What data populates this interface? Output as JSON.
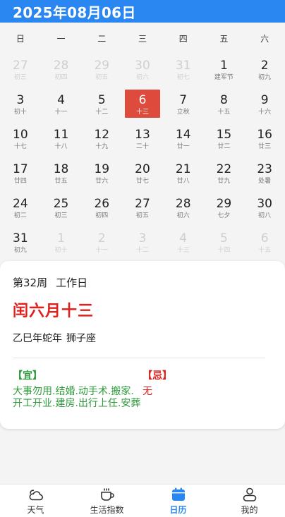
{
  "header": {
    "title": "2025年08月06日"
  },
  "weekdays": [
    "日",
    "一",
    "二",
    "三",
    "四",
    "五",
    "六"
  ],
  "calendar": {
    "days": [
      {
        "d": "27",
        "l": "初三",
        "other": true
      },
      {
        "d": "28",
        "l": "初四",
        "other": true
      },
      {
        "d": "29",
        "l": "初五",
        "other": true
      },
      {
        "d": "30",
        "l": "初六",
        "other": true
      },
      {
        "d": "31",
        "l": "初七",
        "other": true
      },
      {
        "d": "1",
        "l": "建军节"
      },
      {
        "d": "2",
        "l": "初九"
      },
      {
        "d": "3",
        "l": "初十"
      },
      {
        "d": "4",
        "l": "十一"
      },
      {
        "d": "5",
        "l": "十二"
      },
      {
        "d": "6",
        "l": "十三",
        "today": true
      },
      {
        "d": "7",
        "l": "立秋"
      },
      {
        "d": "8",
        "l": "十五"
      },
      {
        "d": "9",
        "l": "十六"
      },
      {
        "d": "10",
        "l": "十七"
      },
      {
        "d": "11",
        "l": "十八"
      },
      {
        "d": "12",
        "l": "十九"
      },
      {
        "d": "13",
        "l": "二十"
      },
      {
        "d": "14",
        "l": "廿一"
      },
      {
        "d": "15",
        "l": "廿二"
      },
      {
        "d": "16",
        "l": "廿三"
      },
      {
        "d": "17",
        "l": "廿四"
      },
      {
        "d": "18",
        "l": "廿五"
      },
      {
        "d": "19",
        "l": "廿六"
      },
      {
        "d": "20",
        "l": "廿七"
      },
      {
        "d": "21",
        "l": "廿八"
      },
      {
        "d": "22",
        "l": "廿九"
      },
      {
        "d": "23",
        "l": "处暑"
      },
      {
        "d": "24",
        "l": "初二"
      },
      {
        "d": "25",
        "l": "初三"
      },
      {
        "d": "26",
        "l": "初四"
      },
      {
        "d": "27",
        "l": "初五"
      },
      {
        "d": "28",
        "l": "初六"
      },
      {
        "d": "29",
        "l": "七夕"
      },
      {
        "d": "30",
        "l": "初八"
      },
      {
        "d": "31",
        "l": "初九"
      },
      {
        "d": "1",
        "l": "初十",
        "other": true
      },
      {
        "d": "2",
        "l": "十一",
        "other": true
      },
      {
        "d": "3",
        "l": "十二",
        "other": true
      },
      {
        "d": "4",
        "l": "十三",
        "other": true
      },
      {
        "d": "5",
        "l": "十四",
        "other": true
      },
      {
        "d": "6",
        "l": "十五",
        "other": true
      }
    ]
  },
  "detail": {
    "week": "第32周",
    "day_type": "工作日",
    "lunar_date": "闰六月十三",
    "ganzhi": "乙巳年蛇年",
    "zodiac": "狮子座",
    "yi_title": "【宜】",
    "yi_text": "大事勿用.结婚.动手术.搬家.开工开业.建房.出行上任.安葬",
    "ji_title": "【忌】",
    "ji_text": "无"
  },
  "tabs": [
    {
      "label": "天气",
      "icon": "weather-icon"
    },
    {
      "label": "生活指数",
      "icon": "life-index-icon"
    },
    {
      "label": "日历",
      "icon": "calendar-icon",
      "active": true
    },
    {
      "label": "我的",
      "icon": "profile-icon"
    }
  ],
  "colors": {
    "accent": "#2a86f0",
    "today": "#de4b3c",
    "yi": "#2e9b3c",
    "ji": "#e0201c"
  }
}
